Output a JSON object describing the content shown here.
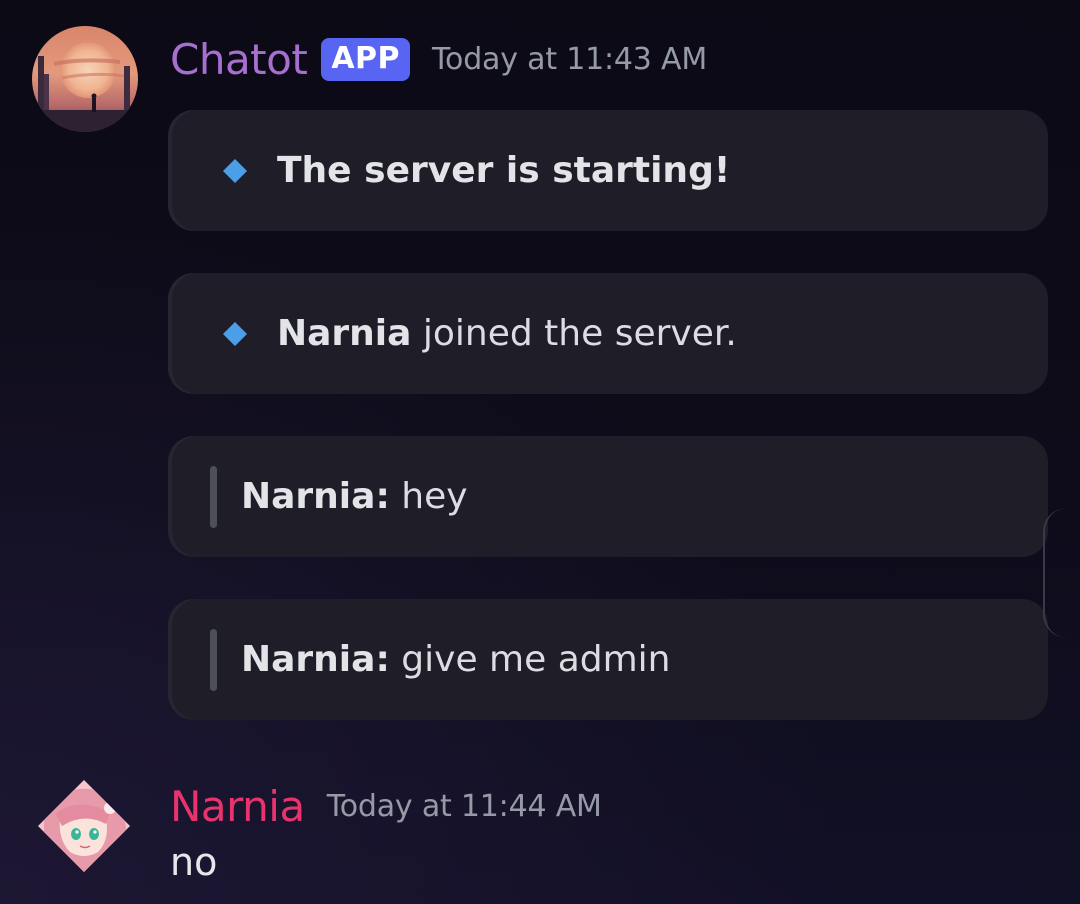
{
  "messages": [
    {
      "author": "Chatot",
      "badge": "APP",
      "timestamp": "Today at 11:43 AM",
      "author_color": "#a66fd0",
      "avatar": "sunset-landscape-avatar",
      "embeds": [
        {
          "icon": "diamond-icon",
          "bold": "The server is starting!",
          "text": ""
        },
        {
          "icon": "diamond-icon",
          "bold": "Narnia",
          "text": " joined the server."
        },
        {
          "icon": "quote-bar",
          "bold": "Narnia:",
          "text": " hey"
        },
        {
          "icon": "quote-bar",
          "bold": "Narnia:",
          "text": " give me admin"
        }
      ]
    },
    {
      "author": "Narnia",
      "timestamp": "Today at 11:44 AM",
      "author_color": "#e8336d",
      "avatar": "anime-girl-avatar",
      "content": "no"
    }
  ],
  "colors": {
    "app_badge": "#5865f2",
    "diamond": "#4a9fe8",
    "embed_bg": "#1f1e28"
  }
}
